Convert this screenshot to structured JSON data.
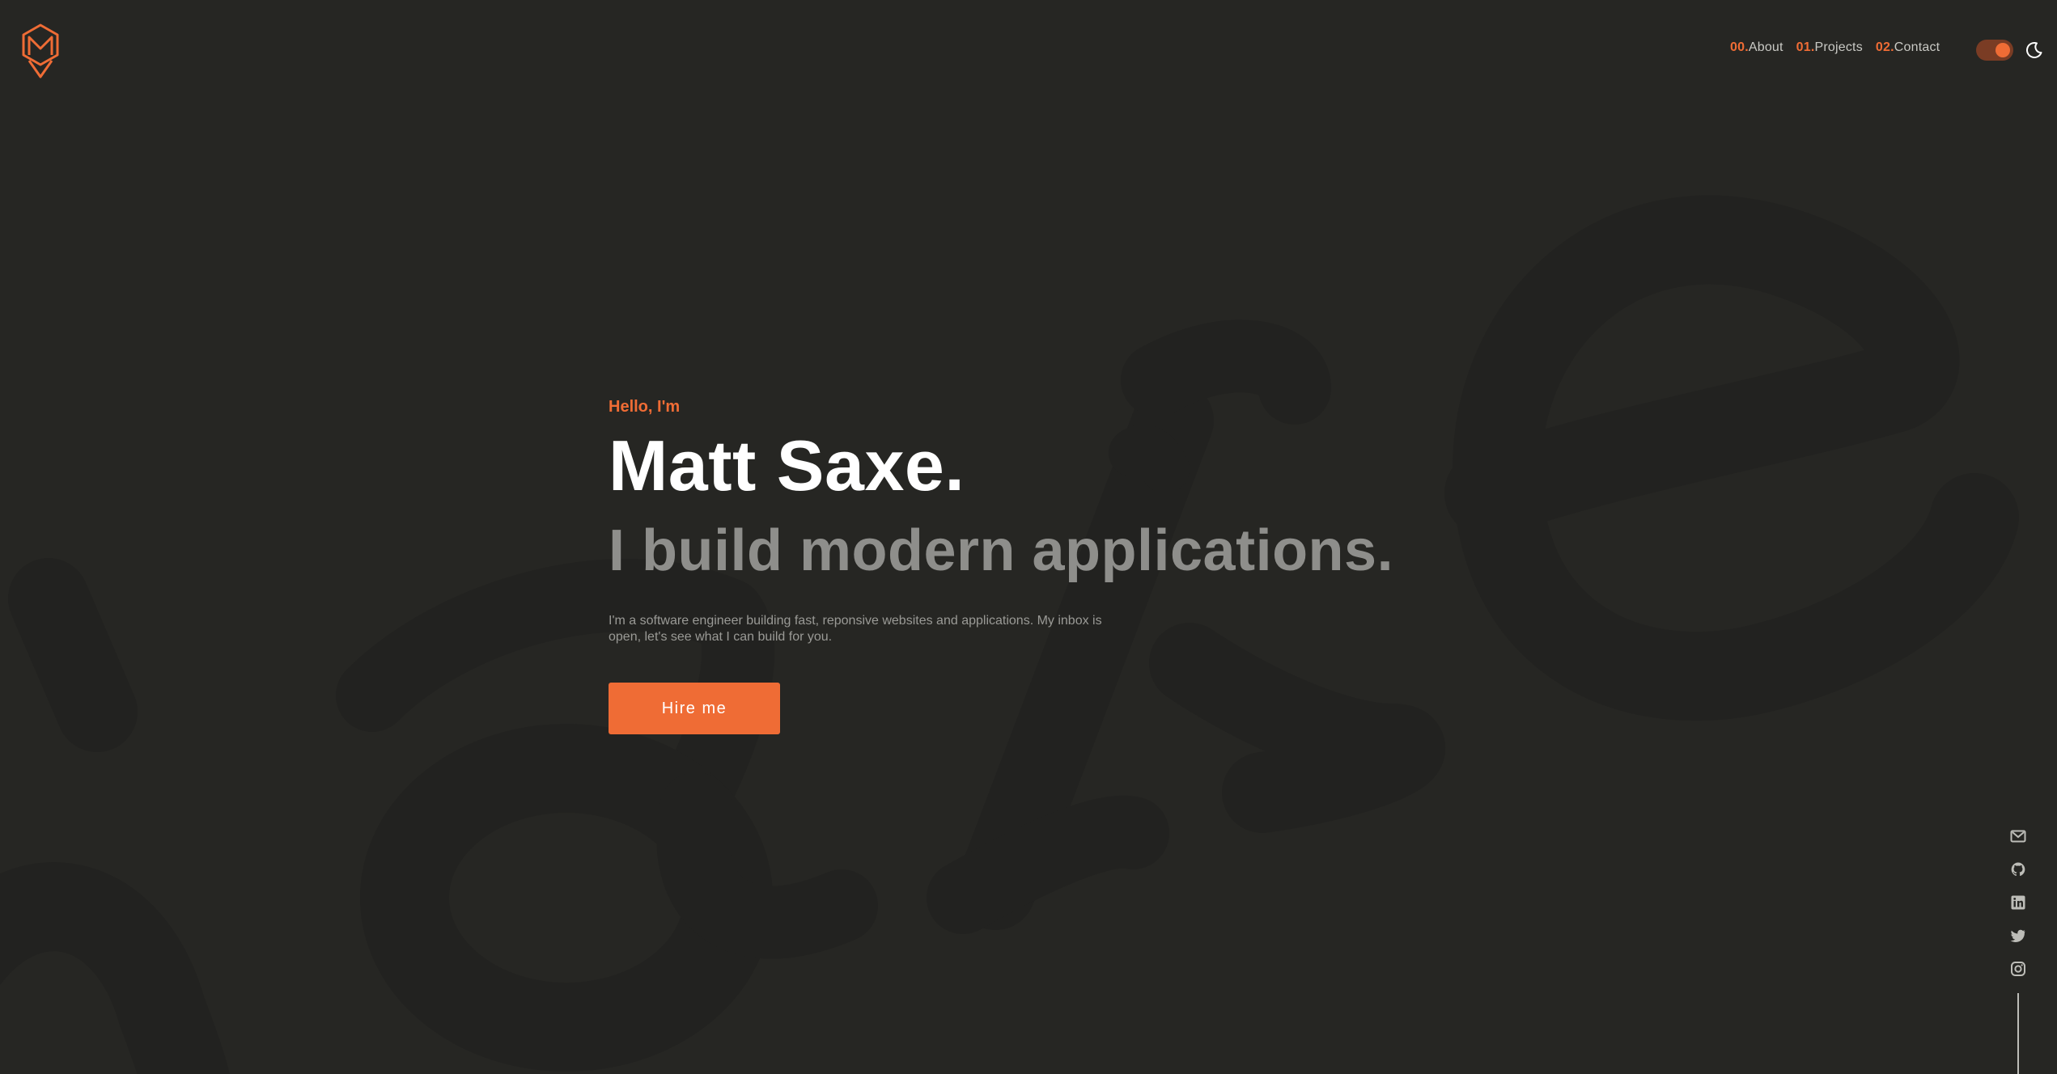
{
  "colors": {
    "accent": "#ef6c35",
    "background": "#262623",
    "text_primary": "#ffffff",
    "text_muted": "#8e8e8b"
  },
  "header": {
    "logo_icon": "m-hexagon-logo",
    "nav": [
      {
        "num": "00.",
        "label": "About"
      },
      {
        "num": "01.",
        "label": "Projects"
      },
      {
        "num": "02.",
        "label": "Contact"
      }
    ],
    "theme_toggle": {
      "state": "dark",
      "icon": "moon-icon"
    }
  },
  "hero": {
    "greeting": "Hello, I'm",
    "name": "Matt Saxe.",
    "tagline": "I build modern applications.",
    "bio": "I'm a software engineer building fast, reponsive websites and applications. My inbox is open, let's see what I can build for you.",
    "cta_label": "Hire me"
  },
  "social": [
    {
      "icon": "gmail-icon"
    },
    {
      "icon": "github-icon"
    },
    {
      "icon": "linkedin-icon"
    },
    {
      "icon": "twitter-icon"
    },
    {
      "icon": "instagram-icon"
    }
  ]
}
